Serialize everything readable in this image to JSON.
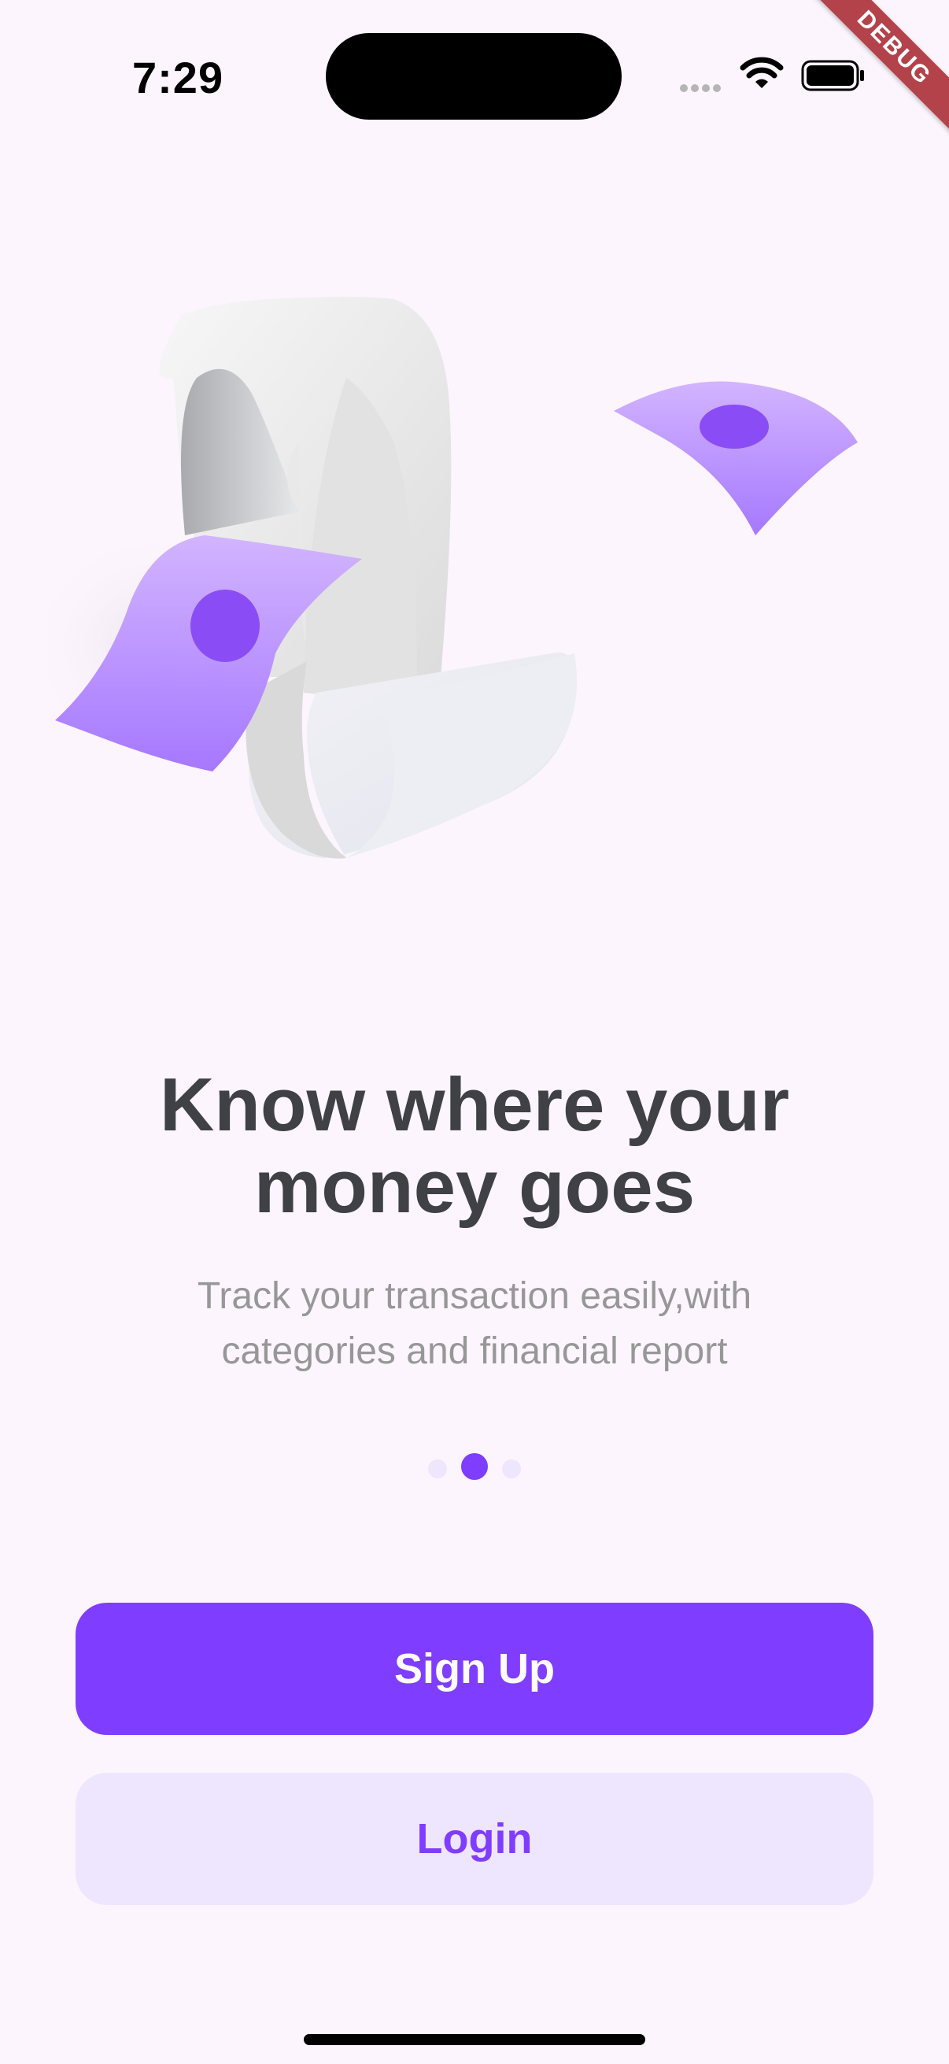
{
  "status_bar": {
    "time": "7:29",
    "icons": [
      "signal-dots-icon",
      "wifi-icon",
      "battery-icon"
    ]
  },
  "debug_banner": "DEBUG",
  "illustration": {
    "icon": "receipt-with-money-icon",
    "colors": {
      "paper": "#E6E6E6",
      "money": "#B98BFF",
      "money_dot": "#8A4DF5"
    }
  },
  "onboarding": {
    "title_line1": "Know where your",
    "title_line2": "money goes",
    "subtitle_line1": "Track your transaction easily,with",
    "subtitle_line2": "categories and financial report",
    "page_indicator": {
      "total": 3,
      "active": 2
    }
  },
  "actions": {
    "signup_label": "Sign Up",
    "login_label": "Login"
  },
  "colors": {
    "background": "#FCF5FD",
    "accent": "#7F3DFF",
    "accent_light": "#EEE5FF",
    "title": "#3F4144",
    "subtitle": "#979798"
  }
}
